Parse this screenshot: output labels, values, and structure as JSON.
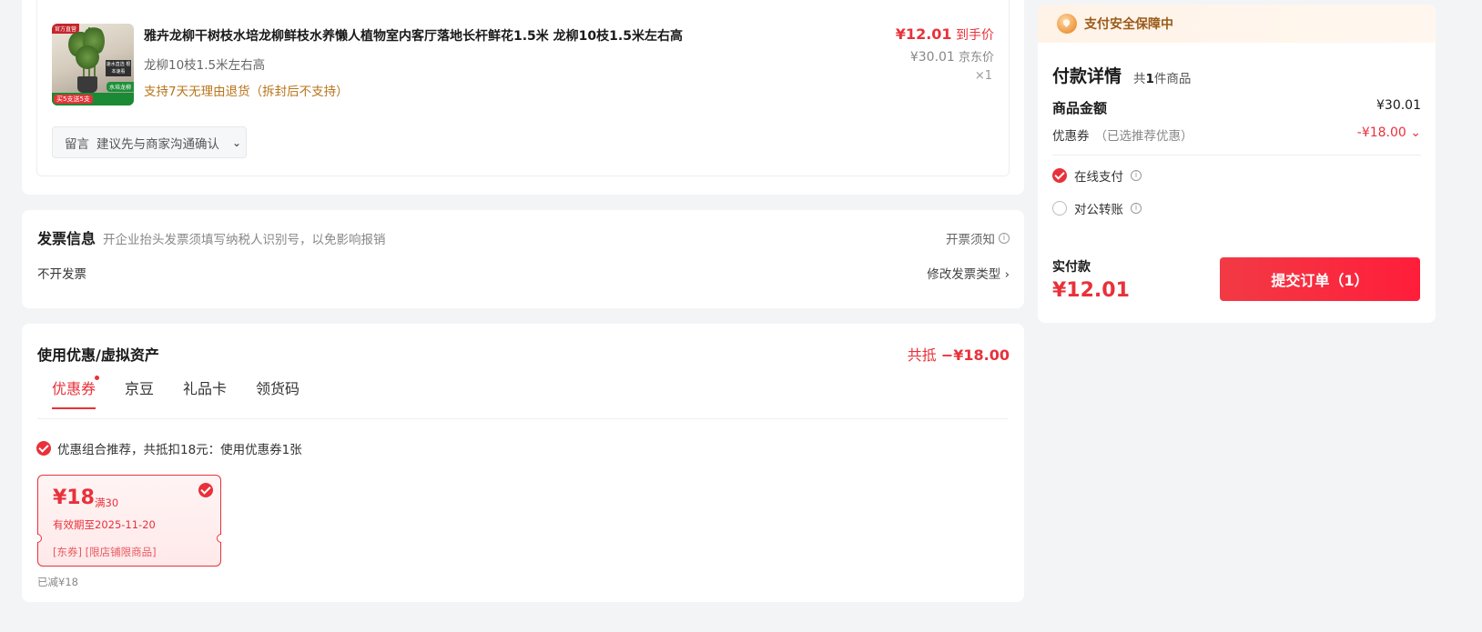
{
  "product": {
    "image_alt": "雅卉龙柳",
    "image_tag_top": "官方直营",
    "image_side_label": "速水直选 根本速看",
    "image_green_tag": "水培龙柳",
    "image_bottom_promo": "买5支送5支",
    "title": "雅卉龙柳干树枝水培龙柳鲜枝水养懒人植物室内客厅落地长杆鲜花1.5米 龙柳10枝1.5米左右高",
    "spec": "龙柳10枝1.5米左右高",
    "return_policy": "支持7天无理由退货（拆封后不支持）",
    "price": "¥12.01",
    "price_label": "到手价",
    "jd_price": "¥30.01",
    "jd_price_label": "京东价",
    "quantity": "×1",
    "message_label": "留言",
    "message_placeholder": "建议先与商家沟通确认"
  },
  "invoice": {
    "title": "发票信息",
    "hint": "开企业抬头发票须填写纳税人识别号，以免影响报销",
    "notice_label": "开票须知",
    "value": "不开发票",
    "modify_label": "修改发票类型"
  },
  "coupons": {
    "title": "使用优惠/虚拟资产",
    "total_prefix": "共抵",
    "total_amount": "−¥18.00",
    "tabs": [
      {
        "label": "优惠券",
        "active": true,
        "dot": true
      },
      {
        "label": "京豆",
        "active": false
      },
      {
        "label": "礼品卡",
        "active": false
      },
      {
        "label": "领货码",
        "active": false
      }
    ],
    "recommend_text": "优惠组合推荐，共抵扣18元：使用优惠券1张",
    "coupon": {
      "value": "¥18",
      "condition": "满30",
      "expiry": "有效期至2025-11-20",
      "scope": "[东券] [限店铺限商品]"
    },
    "reduced_text": "已减¥18"
  },
  "payment": {
    "security_banner": "支付安全保障中",
    "details_title": "付款详情",
    "count_prefix": "共",
    "count_num": "1",
    "count_suffix": "件商品",
    "goods_amount_label": "商品金额",
    "goods_amount_value": "¥30.01",
    "coupon_label": "优惠券",
    "coupon_sub": "（已选推荐优惠）",
    "coupon_value": "-¥18.00",
    "methods": [
      {
        "label": "在线支付",
        "selected": true
      },
      {
        "label": "对公转账",
        "selected": false
      }
    ],
    "actual_label": "实付款",
    "actual_value": "¥12.01",
    "submit_label": "提交订单（1）"
  },
  "colors": {
    "accent": "#e8313a",
    "return_text": "#b8741a",
    "page_bg": "#f3f4f6"
  },
  "icons": [
    "chevron-down-icon",
    "info-icon",
    "chevron-right-icon",
    "check-circle-icon",
    "shield-icon",
    "radio-icon"
  ]
}
